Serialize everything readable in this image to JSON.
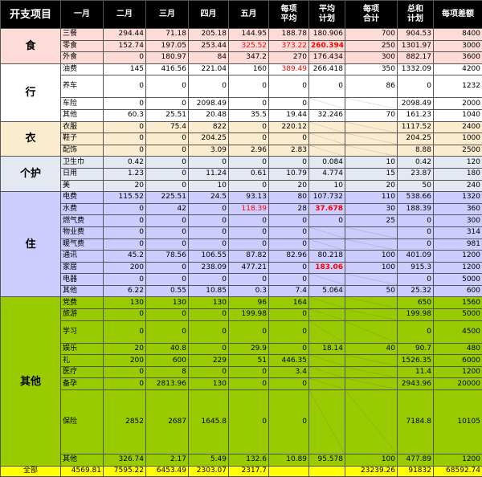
{
  "headers": [
    "开支项目",
    "一月",
    "二月",
    "三月",
    "四月",
    "五月",
    "每项\n平均",
    "平均\n计划",
    "每项\n合计",
    "总和\n计划",
    "每项差额"
  ],
  "groups": [
    {
      "category": "食",
      "theme": "g-food",
      "rows": [
        {
          "name": "三餐",
          "values": [
            "294.44",
            "71.18",
            "205.18",
            "144.95",
            "188.78",
            "180.906",
            "700",
            "904.53",
            "8400",
            "7495.47"
          ]
        },
        {
          "name": "零食",
          "values": [
            "152.74",
            "197.05",
            "253.44",
            "325.52",
            "373.22",
            "260.394",
            "250",
            "1301.97",
            "3000",
            "1698.03"
          ],
          "red_cols": [
            3,
            4,
            5
          ],
          "bold_cols": [
            5
          ]
        },
        {
          "name": "外食",
          "values": [
            "0",
            "180.97",
            "84",
            "347.2",
            "270",
            "176.434",
            "300",
            "882.17",
            "3600",
            "2717.83"
          ]
        }
      ]
    },
    {
      "category": "行",
      "theme": "g-travel",
      "rows": [
        {
          "name": "油费",
          "values": [
            "145",
            "416.56",
            "221.04",
            "160",
            "389.49",
            "266.418",
            "350",
            "1332.09",
            "4200",
            "2867.91"
          ],
          "red_cols": [
            4
          ]
        },
        {
          "name": "养车",
          "values": [
            "0",
            "0",
            "0",
            "0",
            "0",
            "0",
            "86",
            "0",
            "1232",
            "1232"
          ],
          "tall": true
        },
        {
          "name": "车险",
          "values": [
            "0",
            "0",
            "2098.49",
            "0",
            "0",
            "",
            "",
            "2098.49",
            "2000",
            "-98.49"
          ],
          "blank_cols": [
            5,
            6
          ]
        },
        {
          "name": "其他",
          "values": [
            "60.3",
            "25.51",
            "20.48",
            "35.5",
            "19.44",
            "32.246",
            "70",
            "161.23",
            "1040",
            "878.77"
          ]
        }
      ]
    },
    {
      "category": "衣",
      "theme": "g-cloth",
      "rows": [
        {
          "name": "衣服",
          "values": [
            "0",
            "75.4",
            "822",
            "0",
            "220.12",
            "",
            "",
            "1117.52",
            "2400",
            "1882.48"
          ],
          "blank_cols": [
            5,
            6
          ]
        },
        {
          "name": "鞋子",
          "values": [
            "0",
            "0",
            "204.25",
            "0",
            "0",
            "",
            "",
            "204.25",
            "1000",
            "795.75"
          ],
          "blank_cols": [
            5,
            6
          ]
        },
        {
          "name": "配饰",
          "values": [
            "0",
            "0",
            "3.09",
            "2.96",
            "2.83",
            "",
            "",
            "8.88",
            "2500",
            "2491.12"
          ],
          "blank_cols": [
            5,
            6
          ]
        }
      ]
    },
    {
      "category": "个护",
      "theme": "g-care",
      "rows": [
        {
          "name": "卫生巾",
          "values": [
            "0.42",
            "0",
            "0",
            "0",
            "0",
            "0.084",
            "10",
            "0.42",
            "120",
            "119.58"
          ]
        },
        {
          "name": "日用",
          "values": [
            "1.23",
            "0",
            "11.24",
            "0.61",
            "10.79",
            "4.774",
            "15",
            "23.87",
            "180",
            "156.13"
          ]
        },
        {
          "name": "美",
          "values": [
            "20",
            "0",
            "10",
            "0",
            "20",
            "10",
            "20",
            "50",
            "240",
            "190"
          ]
        }
      ]
    },
    {
      "category": "住",
      "theme": "g-live",
      "rows": [
        {
          "name": "电费",
          "values": [
            "115.52",
            "225.51",
            "24.5",
            "93.13",
            "80",
            "107.732",
            "110",
            "538.66",
            "1320",
            "781.34"
          ]
        },
        {
          "name": "水费",
          "values": [
            "0",
            "42",
            "0",
            "118.39",
            "28",
            "37.678",
            "30",
            "188.39",
            "360",
            "171.61"
          ],
          "red_cols": [
            3,
            5
          ],
          "bold_cols": [
            5
          ]
        },
        {
          "name": "燃气费",
          "values": [
            "0",
            "0",
            "0",
            "0",
            "0",
            "0",
            "25",
            "0",
            "300",
            "300"
          ]
        },
        {
          "name": "物业费",
          "values": [
            "0",
            "0",
            "0",
            "0",
            "0",
            "",
            "",
            "0",
            "314",
            "314"
          ],
          "blank_cols": [
            5,
            6
          ]
        },
        {
          "name": "暖气费",
          "values": [
            "0",
            "0",
            "0",
            "0",
            "0",
            "",
            "",
            "0",
            "981",
            "981"
          ],
          "blank_cols": [
            5,
            6
          ]
        },
        {
          "name": "通讯",
          "values": [
            "45.2",
            "78.56",
            "106.55",
            "87.82",
            "82.96",
            "80.218",
            "100",
            "401.09",
            "1200",
            "798.91"
          ]
        },
        {
          "name": "家居",
          "values": [
            "200",
            "0",
            "238.09",
            "477.21",
            "0",
            "183.06",
            "100",
            "915.3",
            "1200",
            "284.7"
          ],
          "red_cols": [
            5
          ],
          "bold_cols": [
            5
          ]
        },
        {
          "name": "电器",
          "values": [
            "0",
            "0",
            "0",
            "0",
            "0",
            "",
            "",
            "0",
            "5000",
            "5000"
          ],
          "blank_cols": [
            5,
            6
          ]
        },
        {
          "name": "其他",
          "values": [
            "6.22",
            "0.55",
            "10.85",
            "0.3",
            "7.4",
            "5.064",
            "50",
            "25.32",
            "600",
            "574.68"
          ]
        }
      ]
    },
    {
      "category": "其他",
      "theme": "g-other",
      "rows": [
        {
          "name": "党费",
          "values": [
            "130",
            "130",
            "130",
            "96",
            "164",
            "",
            "",
            "650",
            "1560",
            "910"
          ],
          "blank_cols": [
            5,
            6
          ]
        },
        {
          "name": "旅游",
          "values": [
            "0",
            "0",
            "0",
            "199.98",
            "0",
            "",
            "",
            "199.98",
            "5000",
            "4800.02"
          ],
          "blank_cols": [
            5,
            6
          ]
        },
        {
          "name": "学习",
          "values": [
            "0",
            "0",
            "0",
            "0",
            "0",
            "",
            "",
            "0",
            "4500",
            "4500"
          ],
          "blank_cols": [
            5,
            6
          ],
          "tall": true
        },
        {
          "name": "娱乐",
          "values": [
            "20",
            "40.8",
            "0",
            "29.9",
            "0",
            "18.14",
            "40",
            "90.7",
            "480",
            "389.3"
          ]
        },
        {
          "name": "礼",
          "values": [
            "200",
            "600",
            "229",
            "51",
            "446.35",
            "",
            "",
            "1526.35",
            "6000",
            "4473.65"
          ],
          "blank_cols": [
            5,
            6
          ]
        },
        {
          "name": "医疗",
          "values": [
            "0",
            "8",
            "0",
            "0",
            "3.4",
            "",
            "",
            "11.4",
            "1200",
            "1188.6"
          ],
          "blank_cols": [
            5,
            6
          ]
        },
        {
          "name": "备孕",
          "values": [
            "0",
            "2813.96",
            "130",
            "0",
            "0",
            "",
            "",
            "2943.96",
            "20000",
            "17056.04"
          ],
          "blank_cols": [
            5,
            6
          ]
        },
        {
          "name": "保险",
          "values": [
            "2852",
            "2687",
            "1645.8",
            "0",
            "0",
            "",
            "",
            "7184.8",
            "10105",
            "2920.2"
          ],
          "blank_cols": [
            5,
            6
          ],
          "xtall": true
        },
        {
          "name": "其他",
          "values": [
            "326.74",
            "2.17",
            "5.49",
            "132.6",
            "10.89",
            "95.578",
            "100",
            "477.89",
            "1200",
            "722.11"
          ]
        }
      ]
    }
  ],
  "total": {
    "label": "全部",
    "values": [
      "4569.81",
      "7595.22",
      "6453.49",
      "2303.07",
      "2317.7",
      "",
      "",
      "23239.26",
      "91832",
      "68592.74"
    ]
  }
}
